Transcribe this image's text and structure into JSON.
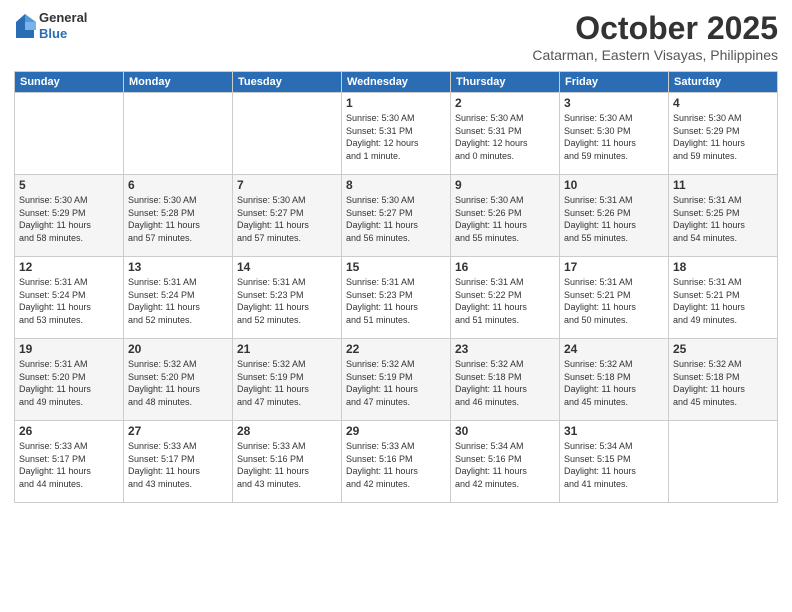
{
  "header": {
    "logo_general": "General",
    "logo_blue": "Blue",
    "month": "October 2025",
    "location": "Catarman, Eastern Visayas, Philippines"
  },
  "days_of_week": [
    "Sunday",
    "Monday",
    "Tuesday",
    "Wednesday",
    "Thursday",
    "Friday",
    "Saturday"
  ],
  "weeks": [
    [
      {
        "day": "",
        "content": ""
      },
      {
        "day": "",
        "content": ""
      },
      {
        "day": "",
        "content": ""
      },
      {
        "day": "1",
        "content": "Sunrise: 5:30 AM\nSunset: 5:31 PM\nDaylight: 12 hours\nand 1 minute."
      },
      {
        "day": "2",
        "content": "Sunrise: 5:30 AM\nSunset: 5:31 PM\nDaylight: 12 hours\nand 0 minutes."
      },
      {
        "day": "3",
        "content": "Sunrise: 5:30 AM\nSunset: 5:30 PM\nDaylight: 11 hours\nand 59 minutes."
      },
      {
        "day": "4",
        "content": "Sunrise: 5:30 AM\nSunset: 5:29 PM\nDaylight: 11 hours\nand 59 minutes."
      }
    ],
    [
      {
        "day": "5",
        "content": "Sunrise: 5:30 AM\nSunset: 5:29 PM\nDaylight: 11 hours\nand 58 minutes."
      },
      {
        "day": "6",
        "content": "Sunrise: 5:30 AM\nSunset: 5:28 PM\nDaylight: 11 hours\nand 57 minutes."
      },
      {
        "day": "7",
        "content": "Sunrise: 5:30 AM\nSunset: 5:27 PM\nDaylight: 11 hours\nand 57 minutes."
      },
      {
        "day": "8",
        "content": "Sunrise: 5:30 AM\nSunset: 5:27 PM\nDaylight: 11 hours\nand 56 minutes."
      },
      {
        "day": "9",
        "content": "Sunrise: 5:30 AM\nSunset: 5:26 PM\nDaylight: 11 hours\nand 55 minutes."
      },
      {
        "day": "10",
        "content": "Sunrise: 5:31 AM\nSunset: 5:26 PM\nDaylight: 11 hours\nand 55 minutes."
      },
      {
        "day": "11",
        "content": "Sunrise: 5:31 AM\nSunset: 5:25 PM\nDaylight: 11 hours\nand 54 minutes."
      }
    ],
    [
      {
        "day": "12",
        "content": "Sunrise: 5:31 AM\nSunset: 5:24 PM\nDaylight: 11 hours\nand 53 minutes."
      },
      {
        "day": "13",
        "content": "Sunrise: 5:31 AM\nSunset: 5:24 PM\nDaylight: 11 hours\nand 52 minutes."
      },
      {
        "day": "14",
        "content": "Sunrise: 5:31 AM\nSunset: 5:23 PM\nDaylight: 11 hours\nand 52 minutes."
      },
      {
        "day": "15",
        "content": "Sunrise: 5:31 AM\nSunset: 5:23 PM\nDaylight: 11 hours\nand 51 minutes."
      },
      {
        "day": "16",
        "content": "Sunrise: 5:31 AM\nSunset: 5:22 PM\nDaylight: 11 hours\nand 51 minutes."
      },
      {
        "day": "17",
        "content": "Sunrise: 5:31 AM\nSunset: 5:21 PM\nDaylight: 11 hours\nand 50 minutes."
      },
      {
        "day": "18",
        "content": "Sunrise: 5:31 AM\nSunset: 5:21 PM\nDaylight: 11 hours\nand 49 minutes."
      }
    ],
    [
      {
        "day": "19",
        "content": "Sunrise: 5:31 AM\nSunset: 5:20 PM\nDaylight: 11 hours\nand 49 minutes."
      },
      {
        "day": "20",
        "content": "Sunrise: 5:32 AM\nSunset: 5:20 PM\nDaylight: 11 hours\nand 48 minutes."
      },
      {
        "day": "21",
        "content": "Sunrise: 5:32 AM\nSunset: 5:19 PM\nDaylight: 11 hours\nand 47 minutes."
      },
      {
        "day": "22",
        "content": "Sunrise: 5:32 AM\nSunset: 5:19 PM\nDaylight: 11 hours\nand 47 minutes."
      },
      {
        "day": "23",
        "content": "Sunrise: 5:32 AM\nSunset: 5:18 PM\nDaylight: 11 hours\nand 46 minutes."
      },
      {
        "day": "24",
        "content": "Sunrise: 5:32 AM\nSunset: 5:18 PM\nDaylight: 11 hours\nand 45 minutes."
      },
      {
        "day": "25",
        "content": "Sunrise: 5:32 AM\nSunset: 5:18 PM\nDaylight: 11 hours\nand 45 minutes."
      }
    ],
    [
      {
        "day": "26",
        "content": "Sunrise: 5:33 AM\nSunset: 5:17 PM\nDaylight: 11 hours\nand 44 minutes."
      },
      {
        "day": "27",
        "content": "Sunrise: 5:33 AM\nSunset: 5:17 PM\nDaylight: 11 hours\nand 43 minutes."
      },
      {
        "day": "28",
        "content": "Sunrise: 5:33 AM\nSunset: 5:16 PM\nDaylight: 11 hours\nand 43 minutes."
      },
      {
        "day": "29",
        "content": "Sunrise: 5:33 AM\nSunset: 5:16 PM\nDaylight: 11 hours\nand 42 minutes."
      },
      {
        "day": "30",
        "content": "Sunrise: 5:34 AM\nSunset: 5:16 PM\nDaylight: 11 hours\nand 42 minutes."
      },
      {
        "day": "31",
        "content": "Sunrise: 5:34 AM\nSunset: 5:15 PM\nDaylight: 11 hours\nand 41 minutes."
      },
      {
        "day": "",
        "content": ""
      }
    ]
  ]
}
